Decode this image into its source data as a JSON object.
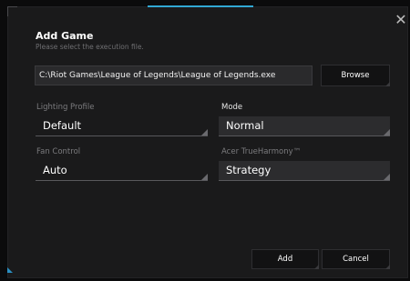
{
  "dialog": {
    "title": "Add Game",
    "subtitle": "Please select the execution file.",
    "close_glyph": "✕"
  },
  "file": {
    "path": "C:\\Riot Games\\League of Legends\\League of Legends.exe",
    "browse_label": "Browse"
  },
  "fields": {
    "lighting_profile": {
      "label": "Lighting Profile",
      "value": "Default"
    },
    "mode": {
      "label": "Mode",
      "value": "Normal"
    },
    "fan_control": {
      "label": "Fan Control",
      "value": "Auto"
    },
    "trueharmony": {
      "label": "Acer TrueHarmony™",
      "value": "Strategy"
    }
  },
  "actions": {
    "add_label": "Add",
    "cancel_label": "Cancel"
  },
  "colors": {
    "accent": "#31a8d4",
    "dialog_bg": "#1a1a1b",
    "input_bg": "#2a2a2c"
  }
}
